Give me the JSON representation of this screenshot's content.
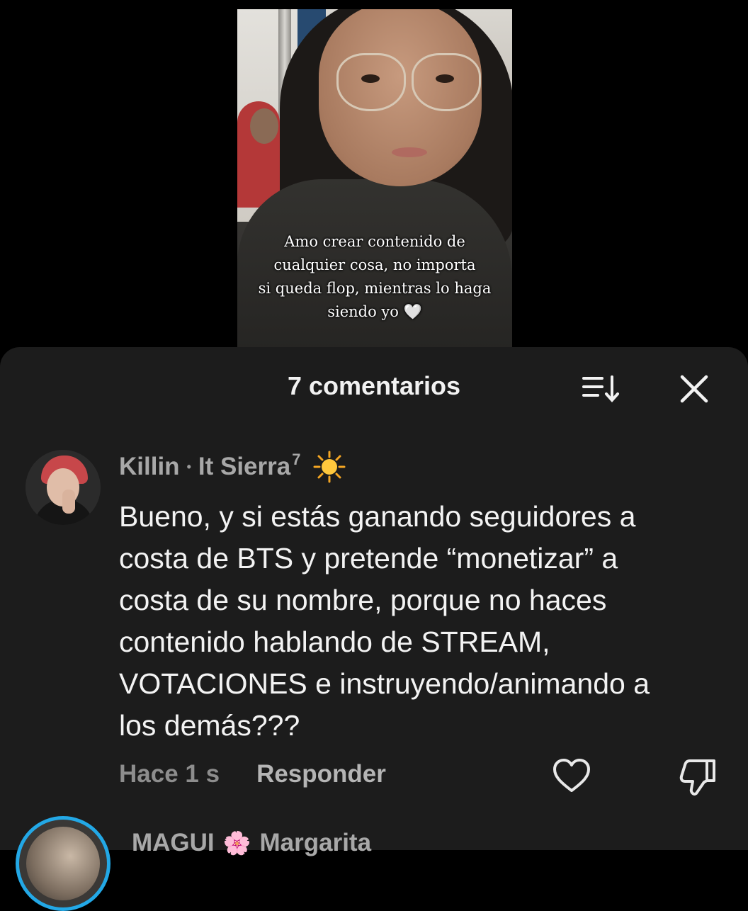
{
  "video": {
    "caption": "Amo crear contenido de\ncualquier cosa, no importa\nsi queda flop, mientras lo haga\nsiendo yo 🤍"
  },
  "sheet": {
    "title": "7 comentarios",
    "sort_icon": "sort-icon",
    "close_icon": "close-icon"
  },
  "comments": [
    {
      "author": "Killin",
      "separator": "•",
      "handle": "It Sierra",
      "handle_sup": "7",
      "badge_icon": "sun-icon",
      "text": "Bueno, y si estás ganando seguidores a\ncosta de BTS y pretende “monetizar” a\ncosta de su nombre, porque no haces\ncontenido hablando de STREAM,\nVOTACIONES e instruyendo/animando a\nlos demás???",
      "time": "Hace 1 s",
      "reply_label": "Responder",
      "like_icon": "heart-icon",
      "dislike_icon": "thumbs-down-icon"
    },
    {
      "author": "MAGUI",
      "flower": "🌸",
      "handle": "Margarita"
    }
  ],
  "colors": {
    "sheet_bg": "#1c1c1c",
    "story_ring": "#23a8e6"
  }
}
